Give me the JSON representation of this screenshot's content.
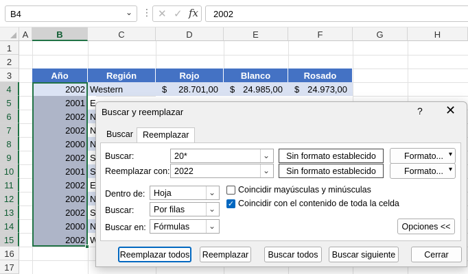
{
  "formula_bar": {
    "name_box": "B4",
    "dots": "⋮",
    "cancel_icon": "✕",
    "enter_icon": "✓",
    "fx_label": "fx",
    "value": "2002"
  },
  "columns": [
    "A",
    "B",
    "C",
    "D",
    "E",
    "F",
    "G",
    "H"
  ],
  "rows": [
    "1",
    "2",
    "3",
    "4",
    "5",
    "6",
    "7",
    "8",
    "9",
    "10",
    "11",
    "12",
    "13",
    "14",
    "15",
    "16",
    "17"
  ],
  "table": {
    "headers": [
      "Año",
      "Región",
      "Rojo",
      "Blanco",
      "Rosado"
    ],
    "row4": {
      "year": "2002",
      "region": "Western",
      "currency": "$",
      "rojo": "28.701,00",
      "blanco": "24.985,00",
      "rosado": "24.973,00"
    },
    "years": [
      "2001",
      "2002",
      "2000",
      "2002",
      "2001",
      "2002",
      "2002",
      "2002",
      "2000",
      "2002"
    ],
    "region_fragments": [
      "Ea",
      "N",
      "N",
      "N",
      "So",
      "Sc",
      "Ea",
      "N",
      "Sc",
      "N",
      "W"
    ]
  },
  "dialog": {
    "title": "Buscar y reemplazar",
    "help": "?",
    "close": "✕",
    "tabs": [
      "Buscar",
      "Reemplazar"
    ],
    "find_label": "Buscar:",
    "find_value": "20*",
    "replace_label": "Reemplazar con:",
    "replace_value": "2022",
    "no_format": "Sin formato establecido",
    "format_button": "Formato...",
    "within_label": "Dentro de:",
    "within_value": "Hoja",
    "search_label": "Buscar:",
    "search_value": "Por filas",
    "lookin_label": "Buscar en:",
    "lookin_value": "Fórmulas",
    "match_case": "Coincidir mayúsculas y minúsculas",
    "match_case_checked": false,
    "match_entire": "Coincidir con el contenido de toda la celda",
    "match_entire_checked": true,
    "options_button": "Opciones <<",
    "buttons": {
      "replace_all": "Reemplazar todos",
      "replace": "Reemplazar",
      "find_all": "Buscar todos",
      "find_next": "Buscar siguiente",
      "close": "Cerrar"
    }
  },
  "colors": {
    "header_blue": "#4472c4",
    "band_light": "#d9e1f2",
    "selection_green": "#217346",
    "selected_fill": "#aeb5c8",
    "checkbox_blue": "#0067c0"
  }
}
